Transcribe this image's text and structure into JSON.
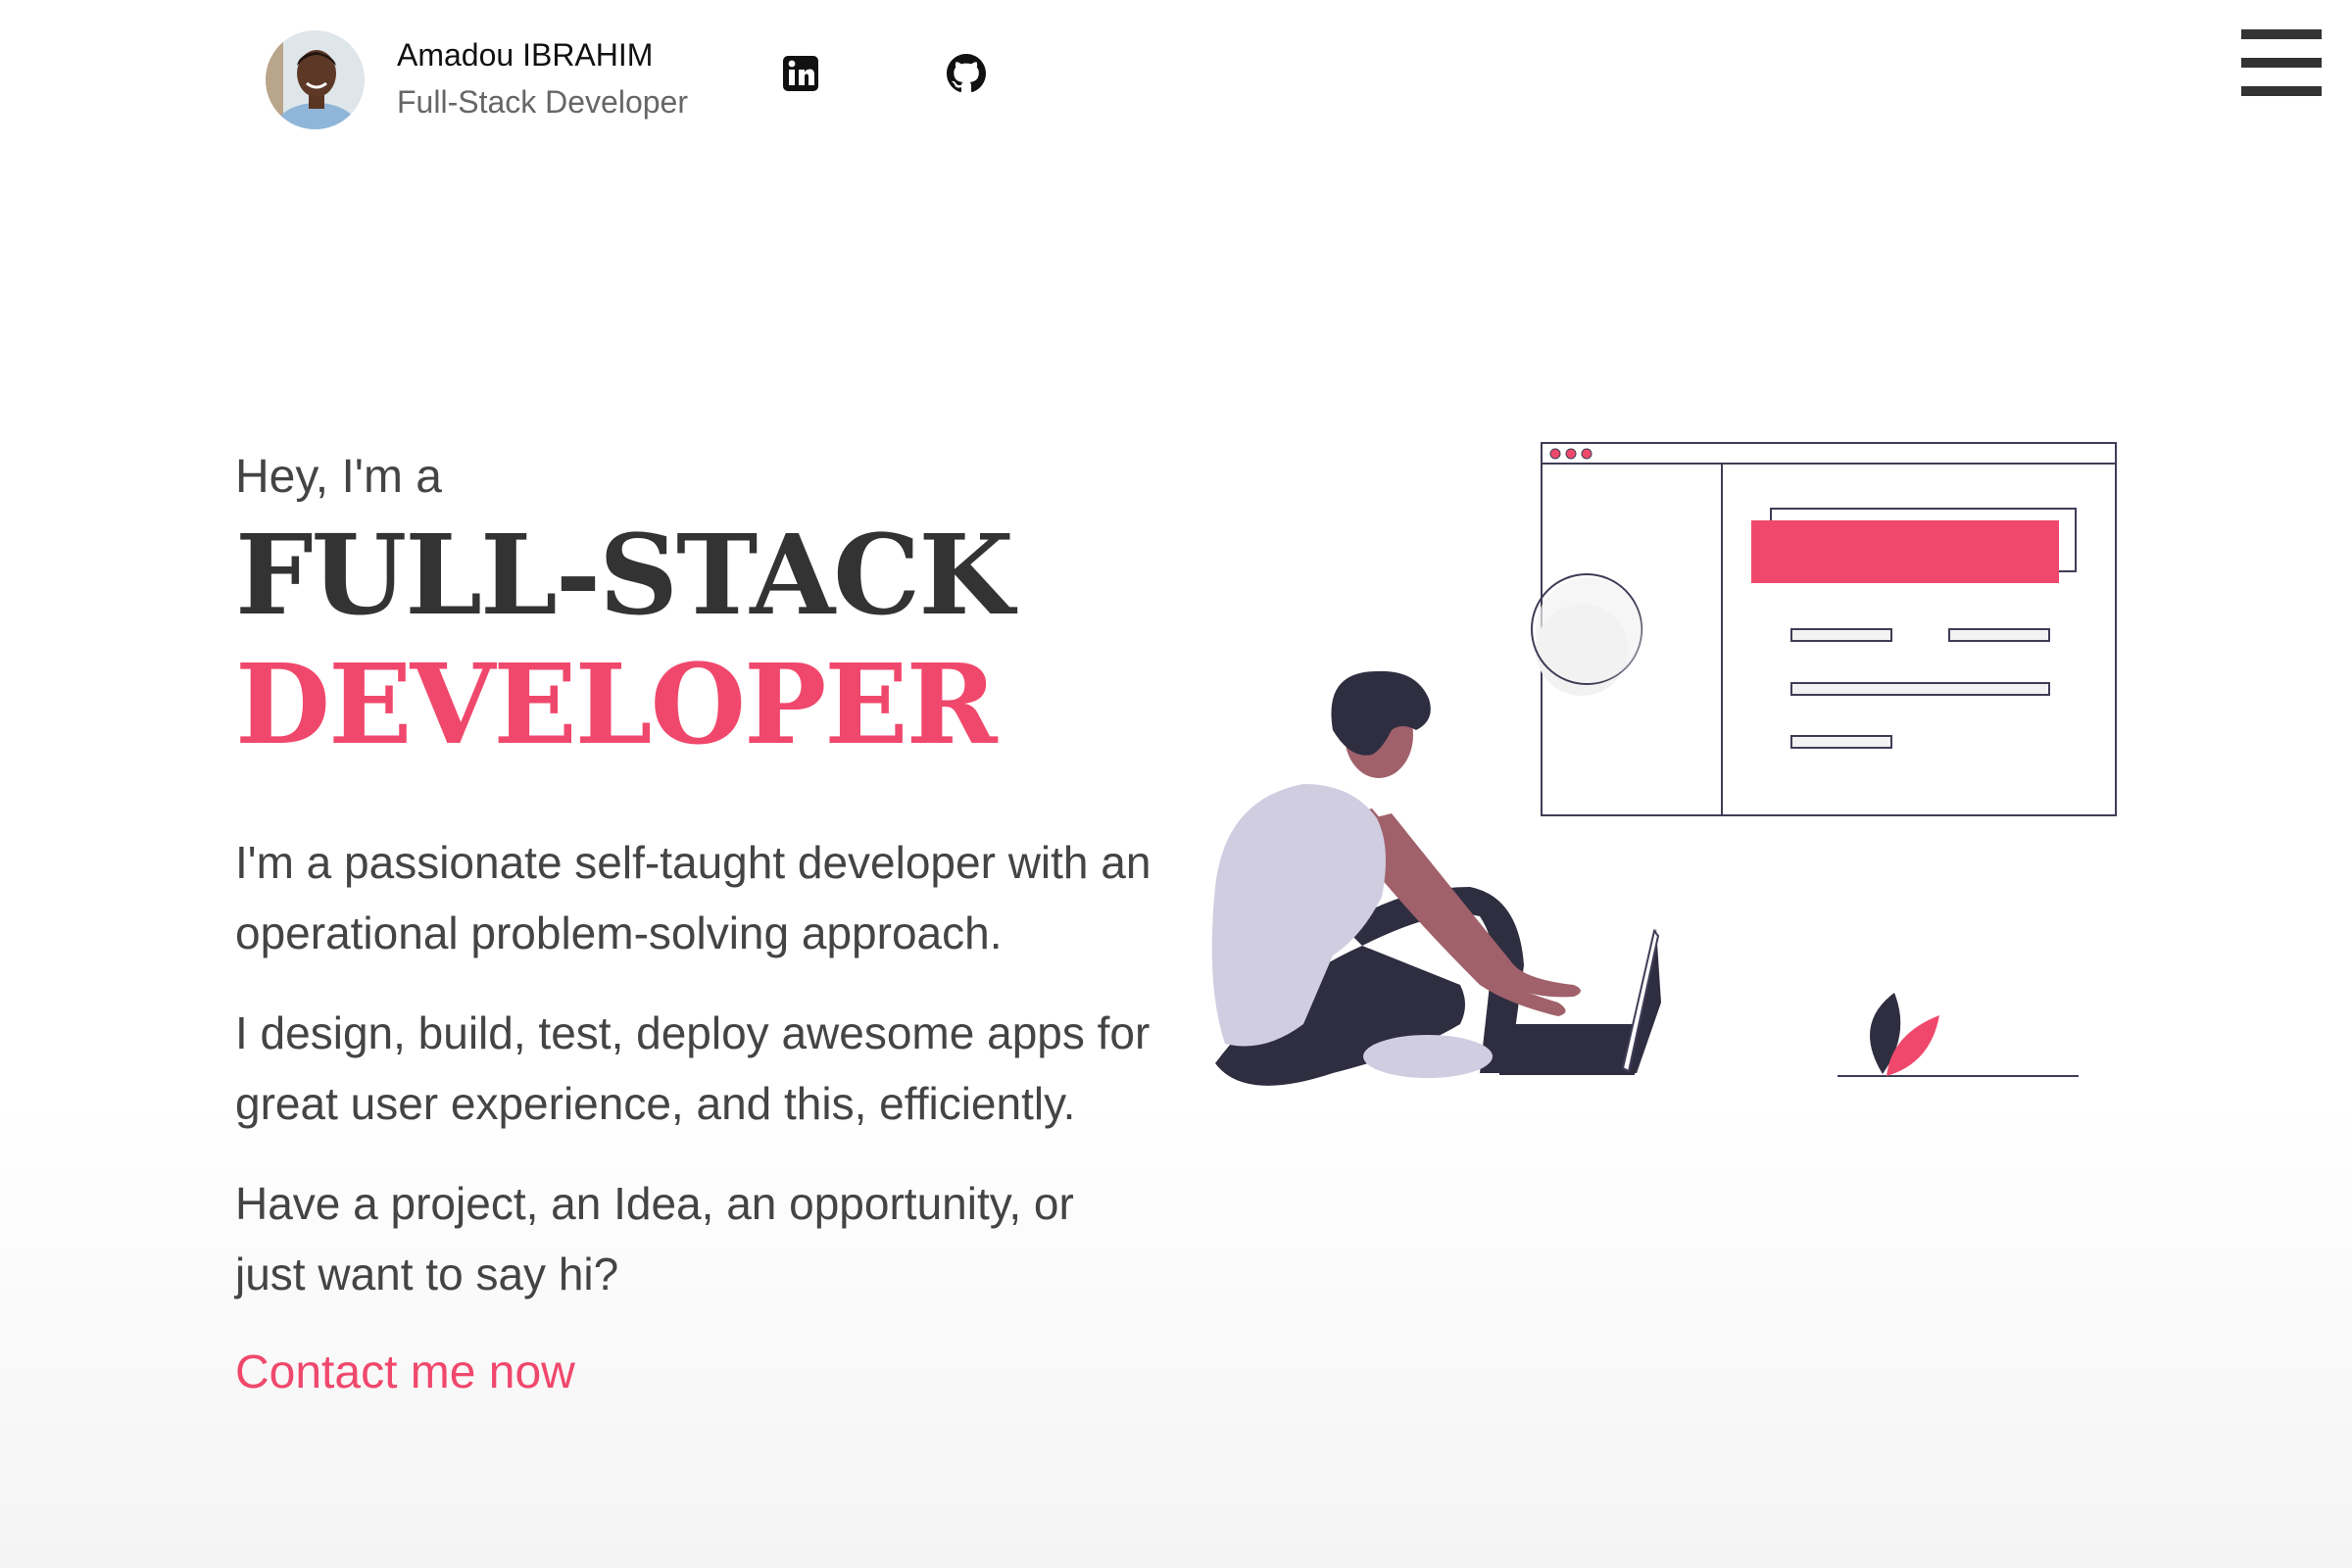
{
  "profile": {
    "name": "Amadou IBRAHIM",
    "role": "Full-Stack Developer",
    "avatar_icon": "avatar-portrait"
  },
  "social": {
    "linkedin_icon": "linkedin-icon",
    "github_icon": "github-icon"
  },
  "menu": {
    "icon": "hamburger-menu-icon"
  },
  "hero": {
    "greeting": "Hey, I'm a",
    "title_line1": "FULL-STACK",
    "title_line2": "DEVELOPER",
    "paragraphs": [
      "I'm a passionate self-taught developer with an operational problem-solving approach.",
      "I design, build, test, deploy awesome apps for great user experience, and this, efficiently.",
      "Have a project, an Idea, an opportunity, or just want to say hi?"
    ],
    "cta_label": "Contact me now"
  },
  "colors": {
    "accent": "#f0486c",
    "dark": "#333333",
    "text": "#444444",
    "muted": "#666666"
  }
}
